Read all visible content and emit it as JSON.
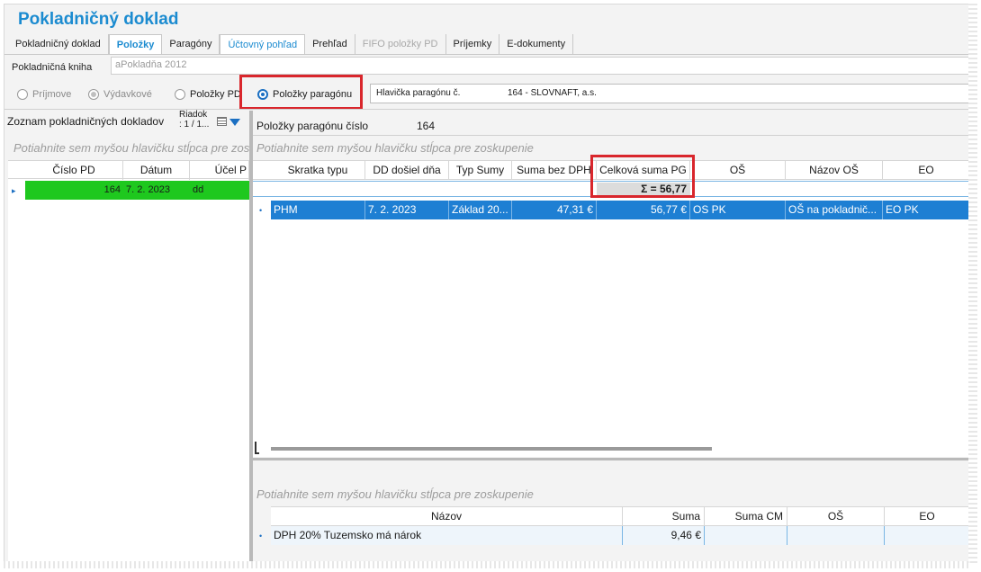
{
  "window": {
    "title": "Pokladničný doklad"
  },
  "tabs": [
    {
      "label": "Pokladničný doklad",
      "state": "normal"
    },
    {
      "label": "Položky",
      "state": "active"
    },
    {
      "label": "Paragóny",
      "state": "normal"
    },
    {
      "label": "Účtovný pohľad",
      "state": "dim"
    },
    {
      "label": "Prehľad",
      "state": "normal"
    },
    {
      "label": "FIFO položky PD",
      "state": "disabled"
    },
    {
      "label": "Príjemky",
      "state": "normal"
    },
    {
      "label": "E-dokumenty",
      "state": "normal"
    }
  ],
  "kniha": {
    "label": "Pokladničná kniha",
    "value": "aPokladňa 2012"
  },
  "radios": {
    "prijmove": "Príjmove",
    "vydavkove": "Výdavkové",
    "polozky_pd": "Položky PD",
    "polozky_paragonu": "Položky paragónu"
  },
  "hlavicka": {
    "label": "Hlavička paragónu č.",
    "value": "164 - SLOVNAFT, a.s."
  },
  "left_panel": {
    "title": "Zoznam pokladničných dokladov",
    "riadok_line1": "Riadok",
    "riadok_line2": ": 1 / 1...",
    "group_hint": "Potiahnite sem myšou hlavičku stĺpca pre zoskupenie",
    "columns": [
      "Číslo PD",
      "Dátum",
      "Účel P"
    ],
    "row": {
      "cislo": "164",
      "datum": "7. 2. 2023",
      "ucel": "dd"
    }
  },
  "right_panel": {
    "title": "Položky paragónu číslo",
    "number": "164",
    "group_hint": "Potiahnite sem myšou hlavičku stĺpca pre zoskupenie",
    "columns": [
      "Skratka typu",
      "DD došiel dňa",
      "Typ Sumy",
      "Suma bez DPH",
      "Celková suma PG",
      "OŠ",
      "Názov OŠ",
      "EO"
    ],
    "sum_text": "Σ =  56,77",
    "row": {
      "skratka": "PHM",
      "dd": "7. 2. 2023",
      "typ": "Základ 20...",
      "suma_bez": "47,31 €",
      "celkova": "56,77 €",
      "os": "OS PK",
      "nazov_os": "OŠ na pokladnič...",
      "eo": "EO PK"
    }
  },
  "bottom_panel": {
    "group_hint": "Potiahnite sem myšou hlavičku stĺpca pre zoskupenie",
    "columns": [
      "Názov",
      "Suma",
      "Suma CM",
      "OŠ",
      "EO"
    ],
    "row": {
      "nazov": "DPH 20% Tuzemsko má nárok",
      "suma": "9,46 €",
      "suma_cm": "",
      "os": "",
      "eo": ""
    }
  },
  "colors": {
    "accent": "#1b8bd0",
    "selection": "#1e7fd3",
    "highlight_row": "#1ec81e",
    "annotation": "#d9262c"
  }
}
